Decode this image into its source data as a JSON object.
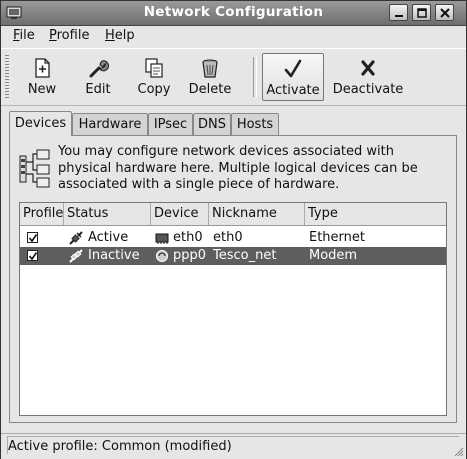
{
  "window": {
    "title": "Network Configuration"
  },
  "menu": [
    {
      "label": "File",
      "mnemonic": "F",
      "rest": "ile"
    },
    {
      "label": "Profile",
      "mnemonic": "P",
      "rest": "rofile"
    },
    {
      "label": "Help",
      "mnemonic": "H",
      "rest": "elp"
    }
  ],
  "toolbar": {
    "new": "New",
    "edit": "Edit",
    "copy": "Copy",
    "delete": "Delete",
    "activate": "Activate",
    "deactivate": "Deactivate"
  },
  "tabs": [
    "Devices",
    "Hardware",
    "IPsec",
    "DNS",
    "Hosts"
  ],
  "info_text": "You may configure network devices associated with physical hardware here.  Multiple logical devices can be associated with a single piece of hardware.",
  "table": {
    "columns": [
      "Profile",
      "Status",
      "Device",
      "Nickname",
      "Type"
    ],
    "rows": [
      {
        "profile_checked": true,
        "status": "Active",
        "device": "eth0",
        "nickname": "eth0",
        "type": "Ethernet",
        "selected": false
      },
      {
        "profile_checked": true,
        "status": "Inactive",
        "device": "ppp0",
        "nickname": "Tesco_net",
        "type": "Modem",
        "selected": true
      }
    ]
  },
  "status_bar": "Active profile: Common (modified)"
}
